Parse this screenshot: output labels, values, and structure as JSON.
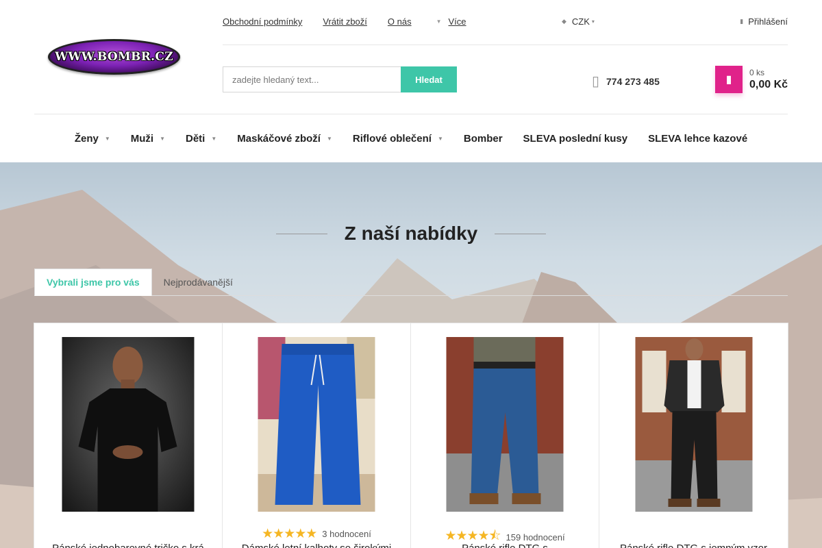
{
  "logo": {
    "text": "WWW.BOMBR.CZ"
  },
  "top_links": [
    {
      "label": "Obchodní podmínky"
    },
    {
      "label": "Vrátit zboží"
    },
    {
      "label": "O nás"
    },
    {
      "label": "Více"
    }
  ],
  "currency": {
    "label": "CZK"
  },
  "login": {
    "label": "Přihlášení"
  },
  "search": {
    "placeholder": "zadejte hledaný text...",
    "button_label": "Hledat"
  },
  "phone": {
    "number": "774 273 485"
  },
  "cart": {
    "count": "0 ks",
    "total": "0,00 Kč"
  },
  "main_nav": [
    {
      "label": "Ženy",
      "has_submenu": true
    },
    {
      "label": "Muži",
      "has_submenu": true
    },
    {
      "label": "Děti",
      "has_submenu": true
    },
    {
      "label": "Maskáčové zboží",
      "has_submenu": true
    },
    {
      "label": "Riflové oblečení",
      "has_submenu": true
    },
    {
      "label": "Bomber",
      "has_submenu": false
    },
    {
      "label": "SLEVA poslední kusy",
      "has_submenu": false
    },
    {
      "label": "SLEVA lehce kazové",
      "has_submenu": false
    }
  ],
  "section": {
    "title": "Z naší nabídky"
  },
  "tabs": [
    {
      "label": "Vybrali jsme pro vás",
      "active": true
    },
    {
      "label": "Nejprodávanější",
      "active": false
    }
  ],
  "products": [
    {
      "name": "Pánské jednobarevné tričko s krá",
      "rating": null,
      "reviews": ""
    },
    {
      "name": "Dámské letní kalhoty se širokými",
      "rating": 5,
      "reviews": "3 hodnocení"
    },
    {
      "name": "Pánské rifle DTG s",
      "rating": 4.5,
      "reviews": "159 hodnocení"
    },
    {
      "name": "Pánské rifle DTG s jemným vzor",
      "rating": null,
      "reviews": ""
    }
  ],
  "colors": {
    "accent": "#3ec6a8",
    "cart": "#e0228a",
    "stars": "#f5b623"
  }
}
